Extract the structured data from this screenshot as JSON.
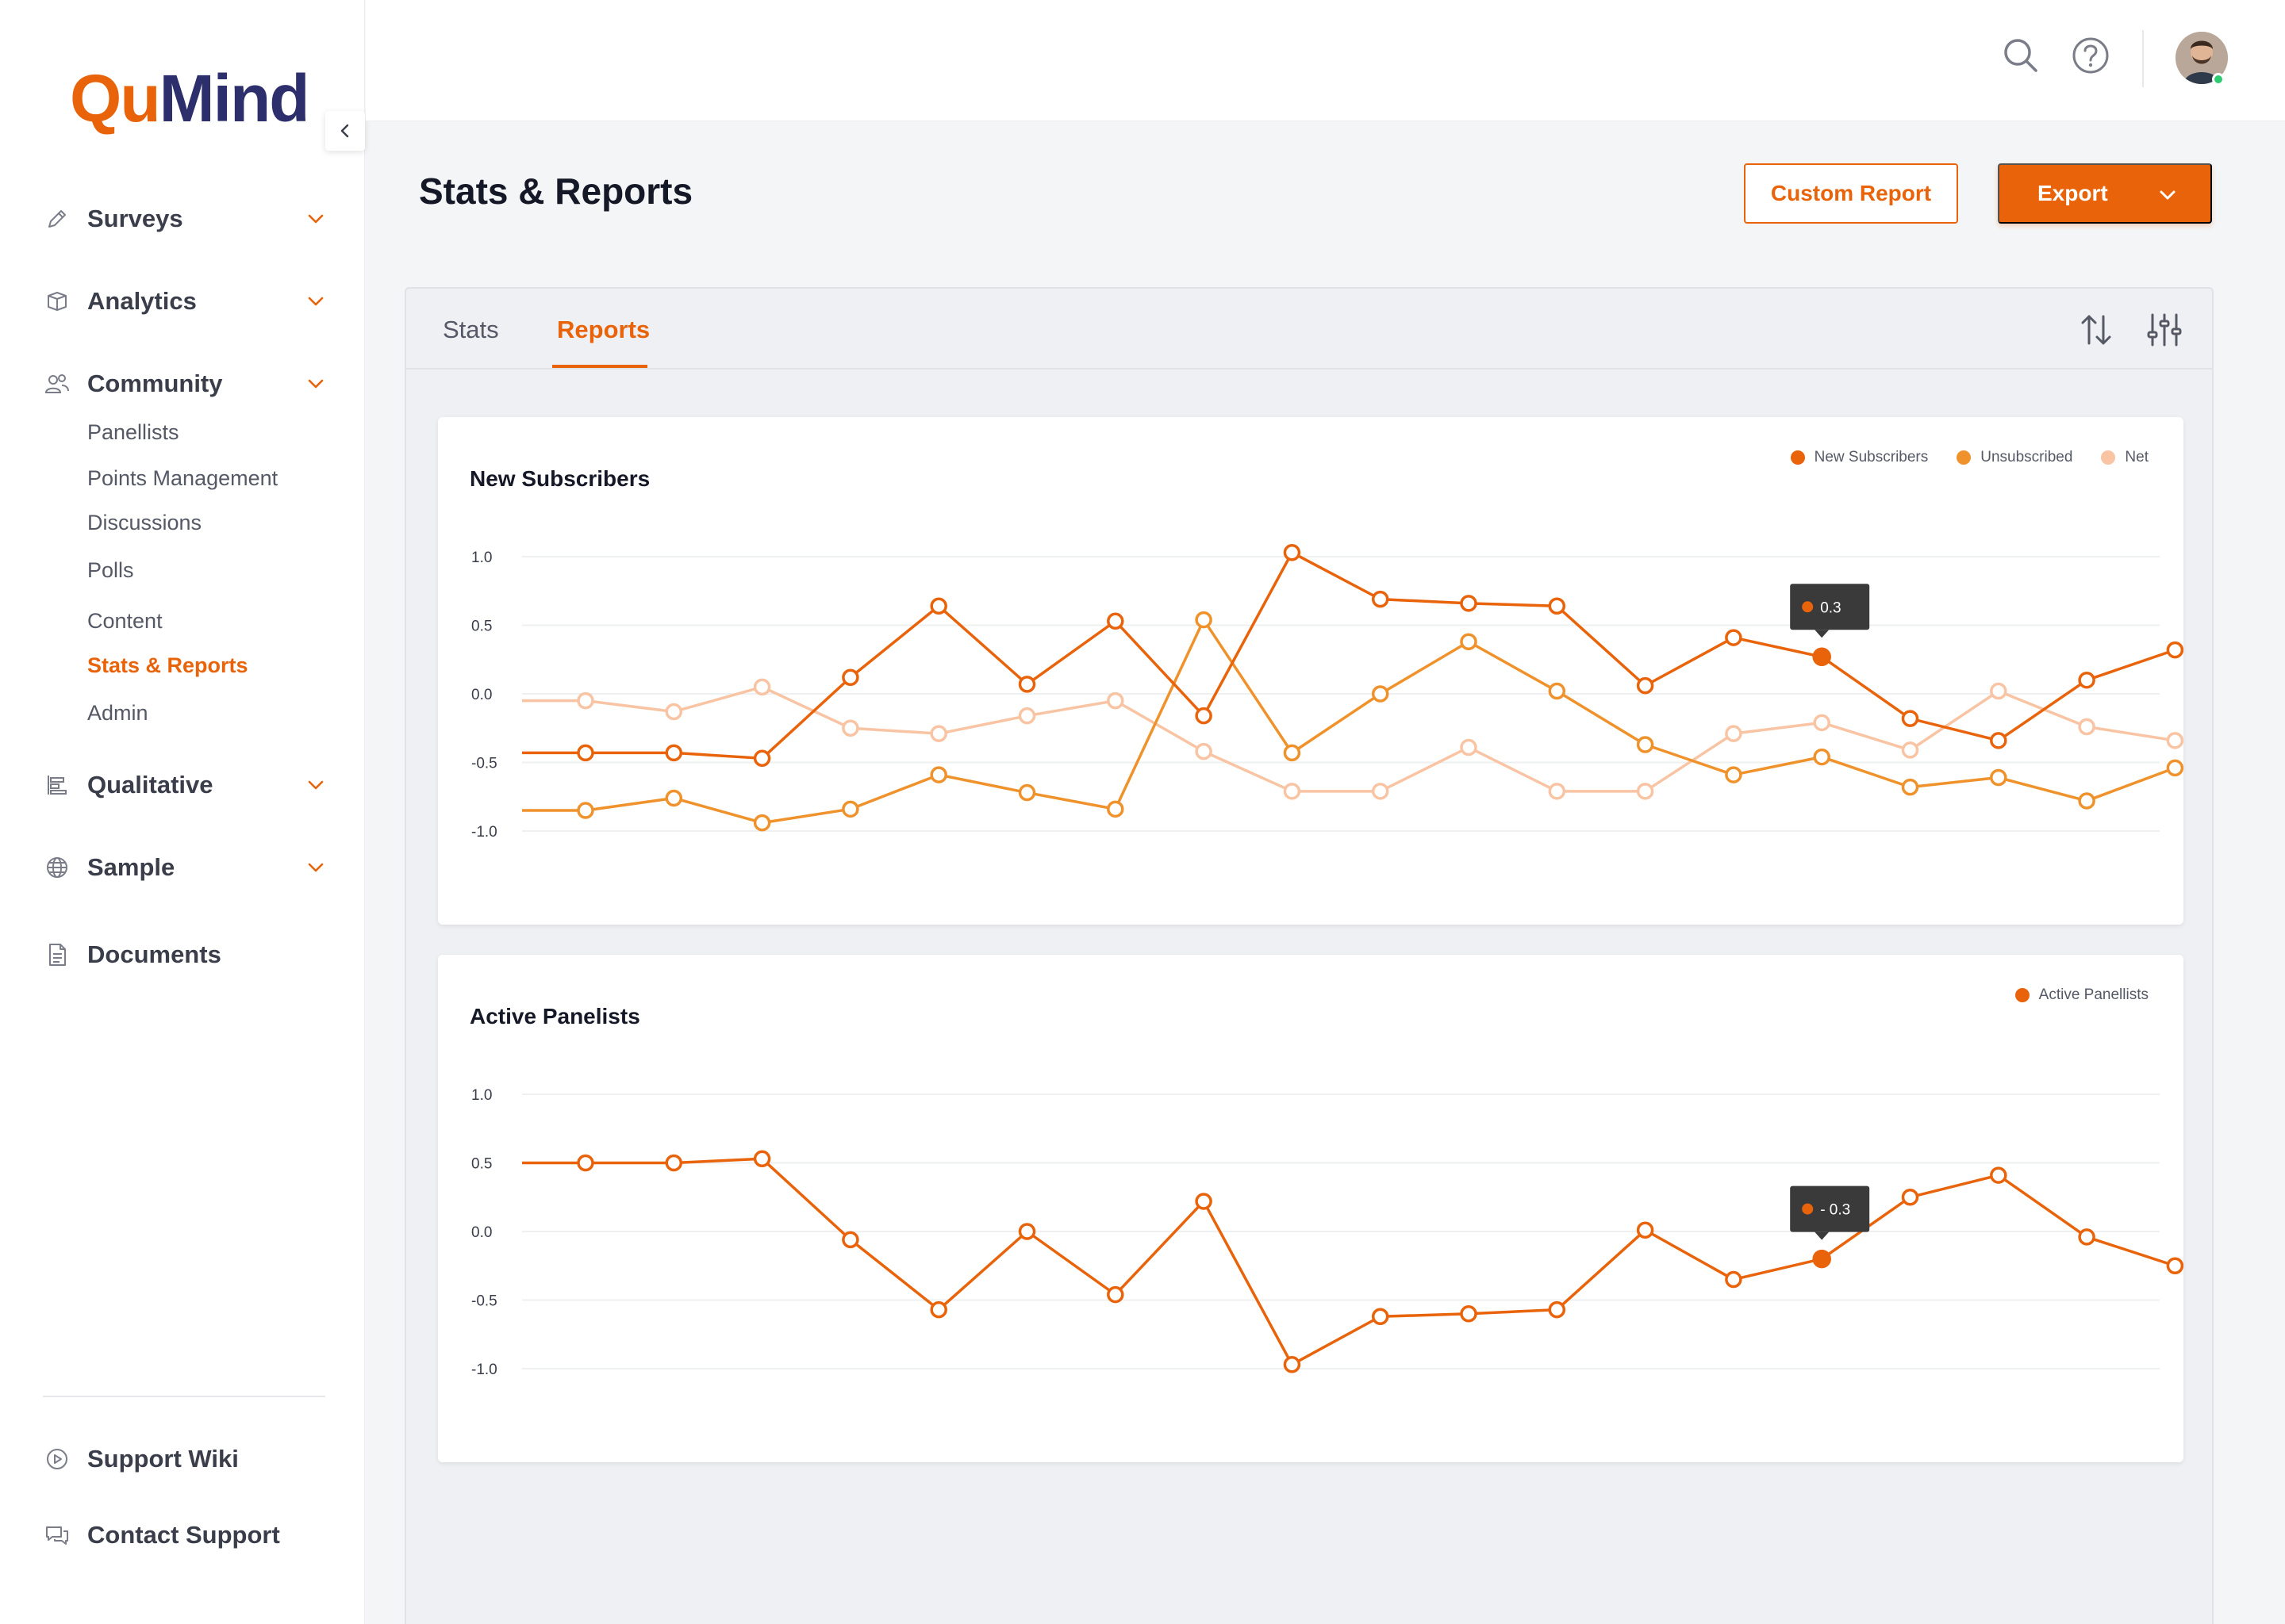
{
  "brand": {
    "logo_part1": "Qu",
    "logo_part2": "Mind"
  },
  "sidebar": {
    "items": [
      {
        "label": "Surveys",
        "icon": "pencil-icon",
        "expandable": true
      },
      {
        "label": "Analytics",
        "icon": "cube-icon",
        "expandable": true
      },
      {
        "label": "Community",
        "icon": "users-icon",
        "expandable": true
      },
      {
        "label": "Qualitative",
        "icon": "bars-icon",
        "expandable": true
      },
      {
        "label": "Sample",
        "icon": "globe-icon",
        "expandable": true
      },
      {
        "label": "Documents",
        "icon": "document-icon",
        "expandable": false
      }
    ],
    "community_subitems": [
      {
        "label": "Panellists"
      },
      {
        "label": "Points Management"
      },
      {
        "label": "Discussions"
      },
      {
        "label": "Polls"
      },
      {
        "label": "Content"
      },
      {
        "label": "Stats & Reports",
        "active": true
      },
      {
        "label": "Admin"
      }
    ],
    "footer": [
      {
        "label": "Support Wiki",
        "icon": "play-circle-icon"
      },
      {
        "label": "Contact Support",
        "icon": "chat-icon"
      }
    ]
  },
  "header": {
    "page_title": "Stats & Reports",
    "custom_report_label": "Custom Report",
    "export_label": "Export"
  },
  "tabs": [
    {
      "label": "Stats",
      "active": false
    },
    {
      "label": "Reports",
      "active": true
    }
  ],
  "colors": {
    "accent": "#e8630a",
    "series_1": "#e8630a",
    "series_2": "#f0922b",
    "series_3": "#f8c4a3",
    "brand_navy": "#2c2f6b"
  },
  "chart_data": [
    {
      "type": "line",
      "title": "New Subscribers",
      "ylim": [
        -1.0,
        1.0
      ],
      "yticks": [
        "1.0",
        "0.5",
        "0.0",
        "-0.5",
        "-1.0"
      ],
      "grid": true,
      "legend_position": "top-right",
      "series": [
        {
          "name": "New Subscribers",
          "values": [
            -0.43,
            -0.43,
            -0.47,
            0.12,
            0.64,
            0.07,
            0.53,
            -0.16,
            1.03,
            0.69,
            0.66,
            0.64,
            0.06,
            0.41,
            0.27,
            -0.18,
            -0.34,
            0.1,
            0.32
          ]
        },
        {
          "name": "Unsubscribed",
          "values": [
            -0.85,
            -0.76,
            -0.94,
            -0.84,
            -0.59,
            -0.72,
            -0.84,
            0.54,
            -0.43,
            0.0,
            0.38,
            0.02,
            -0.37,
            -0.59,
            -0.46,
            -0.68,
            -0.61,
            -0.78,
            -0.54
          ]
        },
        {
          "name": "Net",
          "values": [
            -0.05,
            -0.13,
            0.05,
            -0.25,
            -0.29,
            -0.16,
            -0.05,
            -0.42,
            -0.71,
            -0.71,
            -0.39,
            -0.71,
            -0.71,
            -0.29,
            -0.21,
            -0.41,
            0.02,
            -0.24,
            -0.34
          ]
        }
      ],
      "tooltip": {
        "index": 14,
        "value": "0.3"
      }
    },
    {
      "type": "line",
      "title": "Active Panelists",
      "ylim": [
        -1.0,
        1.0
      ],
      "yticks": [
        "1.0",
        "0.5",
        "0.0",
        "-0.5",
        "-1.0"
      ],
      "grid": true,
      "legend_position": "top-right",
      "series": [
        {
          "name": "Active Panellists",
          "values": [
            0.5,
            0.5,
            0.53,
            -0.06,
            -0.57,
            0.0,
            -0.46,
            0.22,
            -0.97,
            -0.62,
            -0.6,
            -0.57,
            0.01,
            -0.35,
            -0.2,
            0.25,
            0.41,
            -0.04,
            -0.25
          ]
        }
      ],
      "tooltip": {
        "index": 14,
        "value": "- 0.3"
      }
    }
  ]
}
